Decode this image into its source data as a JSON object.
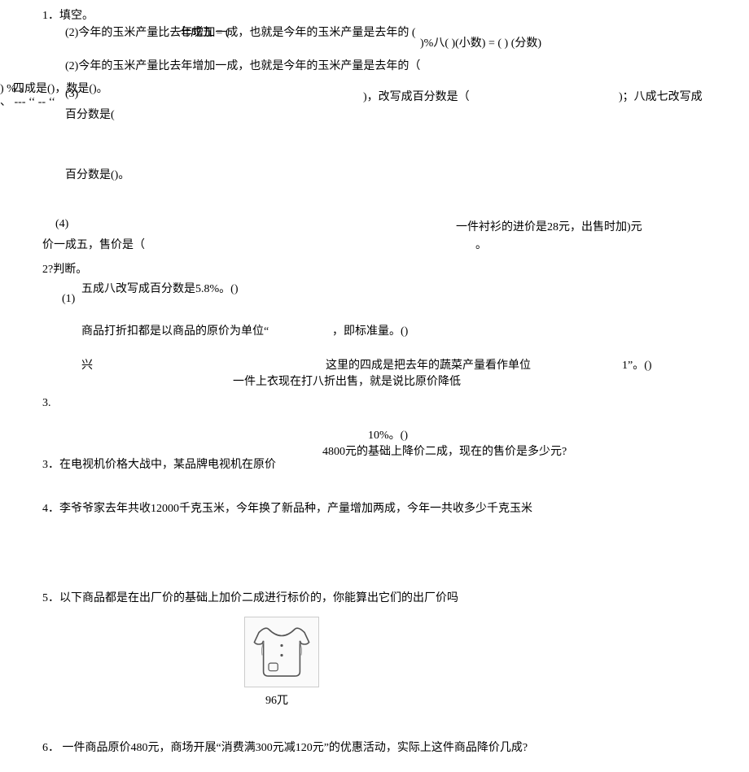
{
  "q1_head": "1．填空。",
  "overlay1": "(2)今年的玉米产量比去年增加一成，也就是今年的玉米产量是去年的 (",
  "overlay1b": "七成五 = (",
  "overlay_tail": ")%八( )(小数) = ( ) (分数)",
  "q1_2": "(2)今年的玉米产量比去年增加一成，也就是今年的玉米产量是去年的（",
  "left_fragment_a": ") % 。",
  "left_fragment_b": "、 --- ‘‘ -- ‘‘",
  "left_fragment_c": "四成是()，数是()。",
  "q1_3_num": "(3)",
  "q1_3_tail1": ")，改写成百分数是（",
  "q1_3_tail2": ")；八成七改写成",
  "baifenshu_shi": "百分数是(",
  "baifenshu_shi2": "百分数是()。",
  "q1_4_num": "(4)",
  "q1_4_right": "一件衬衫的进价是28元，出售时加)元",
  "q1_4_line2a": "价一成五，售价是（",
  "q1_4_dot": "。",
  "q2_head": "2?判断。",
  "q2_1_text": "五成八改写成百分数是5.8%。()",
  "q2_1_num": "(1)",
  "q2_mid1": "商品打折扣都是以商品的原价为单位“",
  "q2_mid1_tail": "，即标准量。()",
  "q2_xing": "兴",
  "q2_line_a": "这里的四成是把去年的蔬菜产量看作单位",
  "q2_line_a_tail": "1”。()",
  "q2_line_b": "一件上衣现在打八折出售，就是说比原价降低",
  "q3_num": "3.",
  "q2_percent": "10%。()",
  "q3_tail": "4800元的基础上降价二成，现在的售价是多少元?",
  "q3_text": "3．在电视机价格大战中，某品牌电视机在原价",
  "q4_text": "4．李爷爷家去年共收12000千克玉米，今年换了新品种，产量增加两成，今年一共收多少千克玉米",
  "q5_text": "5．以下商品都是在出厂价的基础上加价二成进行标价的，你能算出它们的出厂价吗",
  "price_label": "96兀",
  "q6_text": "6． 一件商品原价480元，商场开展“消费满300元减120元”的优惠活动，实际上这件商品降价几成?"
}
